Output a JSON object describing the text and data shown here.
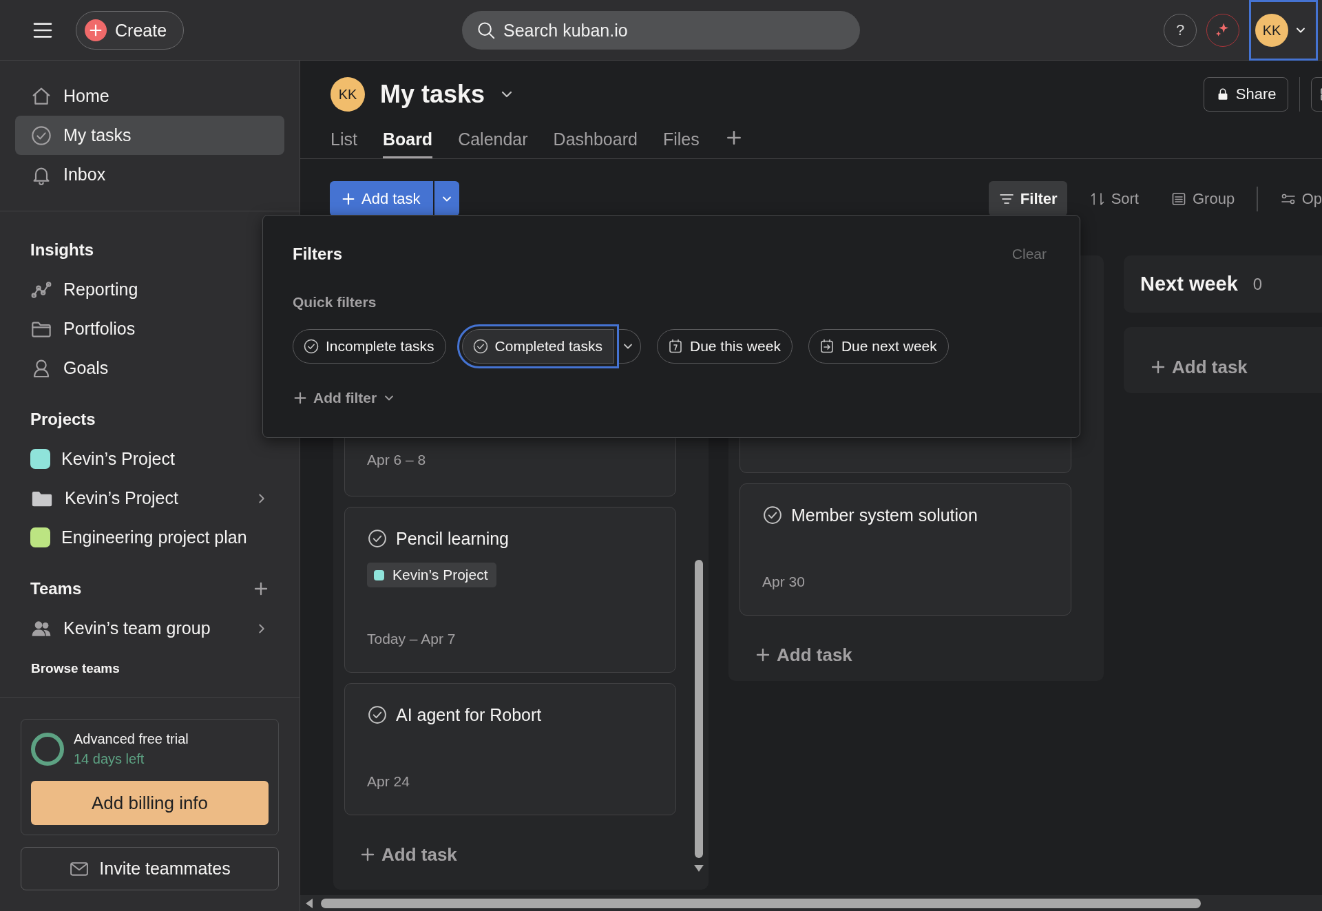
{
  "topbar": {
    "create_label": "Create",
    "search_placeholder": "Search kuban.io",
    "help_label": "?",
    "avatar_initials": "KK",
    "avatar_selected": true
  },
  "sidebar": {
    "nav": [
      {
        "label": "Home",
        "kind": "home",
        "selected": false
      },
      {
        "label": "My tasks",
        "kind": "check",
        "selected": true
      },
      {
        "label": "Inbox",
        "kind": "bell",
        "selected": false
      }
    ],
    "insights": {
      "title": "Insights",
      "items": [
        {
          "label": "Reporting",
          "kind": "chart"
        },
        {
          "label": "Portfolios",
          "kind": "folder"
        },
        {
          "label": "Goals",
          "kind": "person"
        }
      ]
    },
    "projects": {
      "title": "Projects",
      "items": [
        {
          "label": "Kevin’s Project",
          "kind": "swatch",
          "color": "#8fe3da",
          "expandable": false
        },
        {
          "label": "Kevin’s Project",
          "kind": "folder",
          "expandable": true
        },
        {
          "label": "Engineering project plan",
          "kind": "swatch",
          "color": "#bce482",
          "expandable": false
        }
      ]
    },
    "teams": {
      "title": "Teams",
      "items": [
        {
          "label": "Kevin’s team group",
          "expandable": true
        }
      ],
      "browse": "Browse teams"
    },
    "trial": {
      "title": "Advanced free trial",
      "days_left": "14 days left",
      "button": "Add billing info"
    },
    "invite": "Invite teammates"
  },
  "header": {
    "avatar_initials": "KK",
    "title": "My tasks",
    "share": "Share",
    "tabs": [
      {
        "label": "List",
        "selected": false
      },
      {
        "label": "Board",
        "selected": true
      },
      {
        "label": "Calendar",
        "selected": false
      },
      {
        "label": "Dashboard",
        "selected": false
      },
      {
        "label": "Files",
        "selected": false
      }
    ]
  },
  "toolbar": {
    "add_task": "Add task",
    "actions": [
      {
        "label": "Filter",
        "kind": "filter",
        "selected": true
      },
      {
        "label": "Sort",
        "kind": "sort",
        "selected": false
      },
      {
        "label": "Group",
        "kind": "group",
        "selected": false
      },
      {
        "label": "Op",
        "kind": "options",
        "selected": false
      }
    ]
  },
  "filters": {
    "title": "Filters",
    "clear": "Clear",
    "section": "Quick filters",
    "add_filter": "Add filter",
    "chips": [
      {
        "label": "Incomplete tasks",
        "kind": "check",
        "selected": false,
        "has_menu": false
      },
      {
        "label": "Completed tasks",
        "kind": "check",
        "selected": true,
        "has_menu": true
      },
      {
        "label": "Due this week",
        "kind": "calendar",
        "selected": false,
        "has_menu": false
      },
      {
        "label": "Due next week",
        "kind": "calendar-next",
        "selected": false,
        "has_menu": false
      }
    ]
  },
  "board": {
    "columns": [
      {
        "cards": [
          {
            "kind": "date-only",
            "date": "Apr 6 – 8"
          },
          {
            "kind": "task",
            "title": "Pencil learning",
            "project": {
              "label": "Kevin’s Project",
              "color": "#8fe3da"
            },
            "date": "Today – Apr 7"
          },
          {
            "kind": "task",
            "title": "AI agent for Robort",
            "date": "Apr 24"
          }
        ],
        "add_task": "Add task",
        "scrollable": true
      },
      {
        "cards": [
          {
            "kind": "covered"
          },
          {
            "kind": "task",
            "title": "Member system solution",
            "date": "Apr 30"
          }
        ],
        "add_task": "Add task",
        "scrollable": false
      },
      {
        "title": "Next week",
        "count": "0",
        "add_task": "Add task",
        "scrollable": false
      }
    ]
  }
}
